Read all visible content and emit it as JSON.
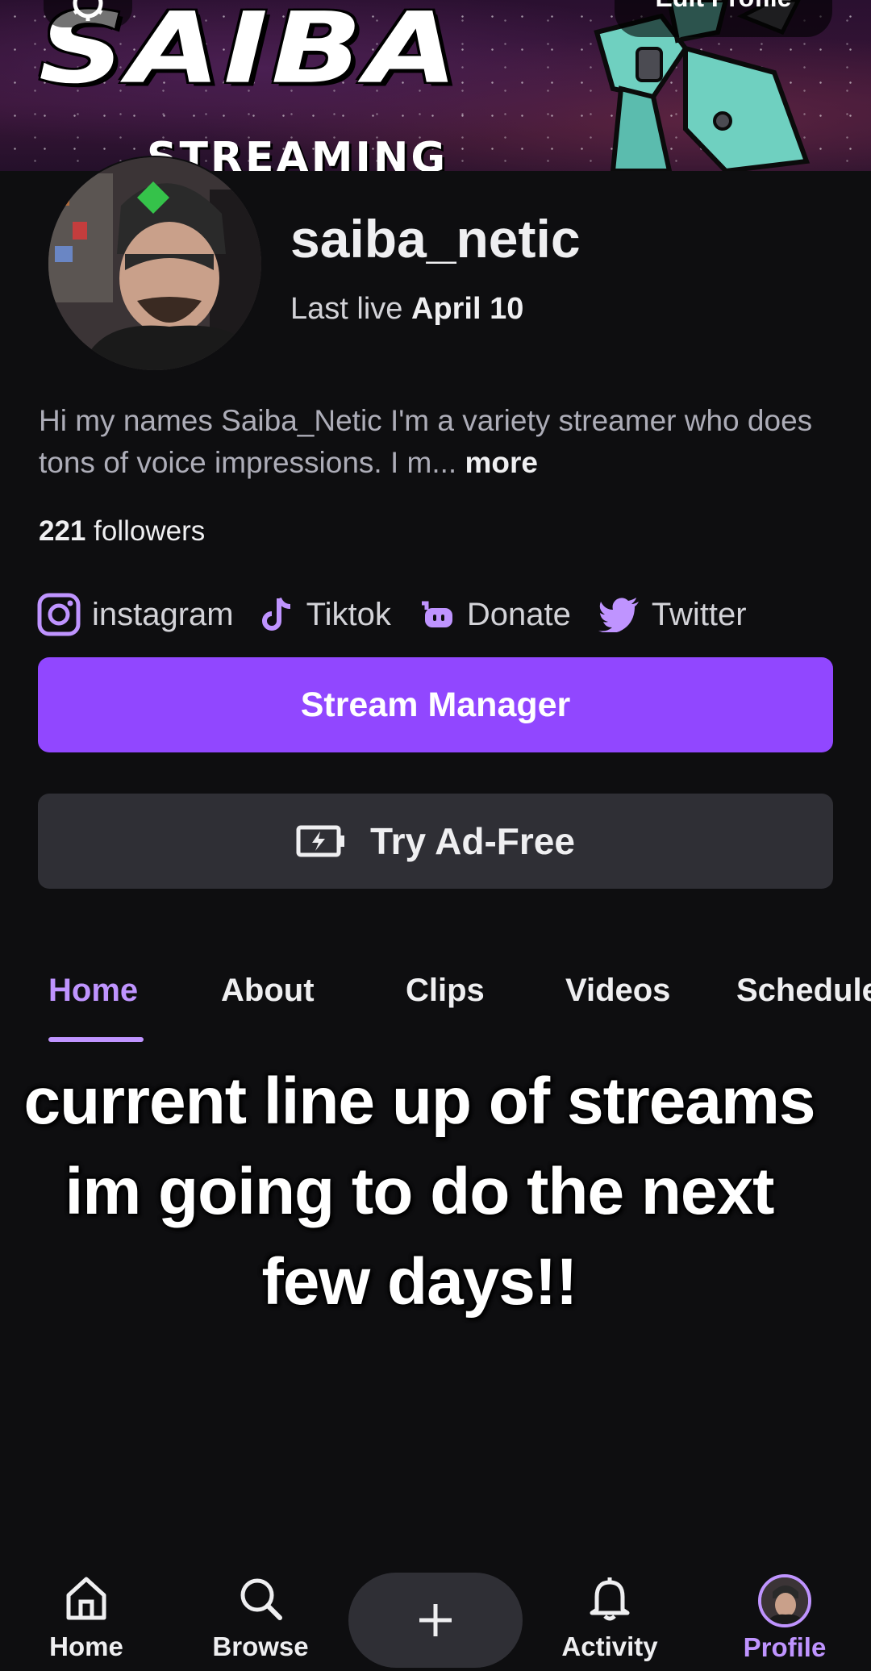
{
  "banner": {
    "logo_text": "SAIBA",
    "logo_subtitle": "STREAMING",
    "edit_profile_label": "Edit Profile"
  },
  "profile": {
    "username": "saiba_netic",
    "last_live_prefix": "Last live",
    "last_live_date": "April 10",
    "bio": "Hi my names Saiba_Netic I'm a variety streamer who does tons of voice impressions. I m...",
    "bio_more": "more",
    "followers_count": "221",
    "followers_label": "followers"
  },
  "socials": [
    {
      "label": "instagram",
      "icon": "instagram-icon"
    },
    {
      "label": "Tiktok",
      "icon": "tiktok-icon"
    },
    {
      "label": "Donate",
      "icon": "streamlabs-icon"
    },
    {
      "label": "Twitter",
      "icon": "twitter-icon"
    }
  ],
  "buttons": {
    "stream_manager": "Stream Manager",
    "ad_free": "Try Ad-Free"
  },
  "tabs": [
    {
      "label": "Home",
      "active": true
    },
    {
      "label": "About",
      "active": false
    },
    {
      "label": "Clips",
      "active": false
    },
    {
      "label": "Videos",
      "active": false
    },
    {
      "label": "Schedule",
      "active": false
    }
  ],
  "caption": {
    "line1": "current line up of streams",
    "line2": "im going to do the next",
    "line3": "few days!!"
  },
  "bottom_nav": [
    {
      "label": "Home",
      "icon": "home-icon"
    },
    {
      "label": "Browse",
      "icon": "search-icon"
    },
    {
      "label": "",
      "icon": "plus-icon"
    },
    {
      "label": "Activity",
      "icon": "bell-icon"
    },
    {
      "label": "Profile",
      "icon": "avatar",
      "active": true
    }
  ],
  "colors": {
    "accent": "#9147ff",
    "accent_light": "#bf94ff",
    "background": "#0e0e10",
    "secondary_button": "#2f2f35"
  }
}
